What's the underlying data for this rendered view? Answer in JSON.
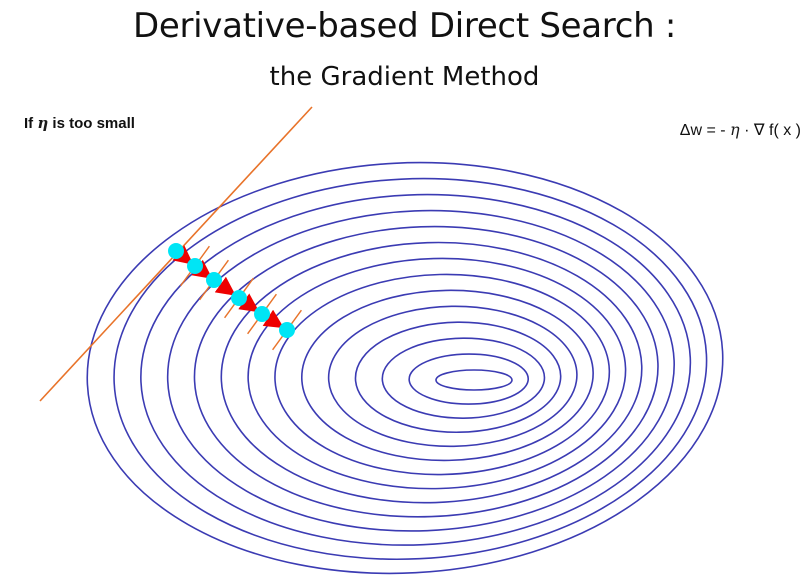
{
  "title": "Derivative-based Direct Search :",
  "subtitle": "the Gradient Method",
  "condition": {
    "prefix": "If ",
    "eta": "η",
    "suffix": " is too small"
  },
  "formula": {
    "lhs": "Δw = - ",
    "eta": "η",
    "rest": " · ∇ f( x )"
  },
  "colors": {
    "contour": "#3b3bb3",
    "tangent": "#e8732a",
    "step_arrow": "#ee0000",
    "point": "#00e5f5"
  }
}
